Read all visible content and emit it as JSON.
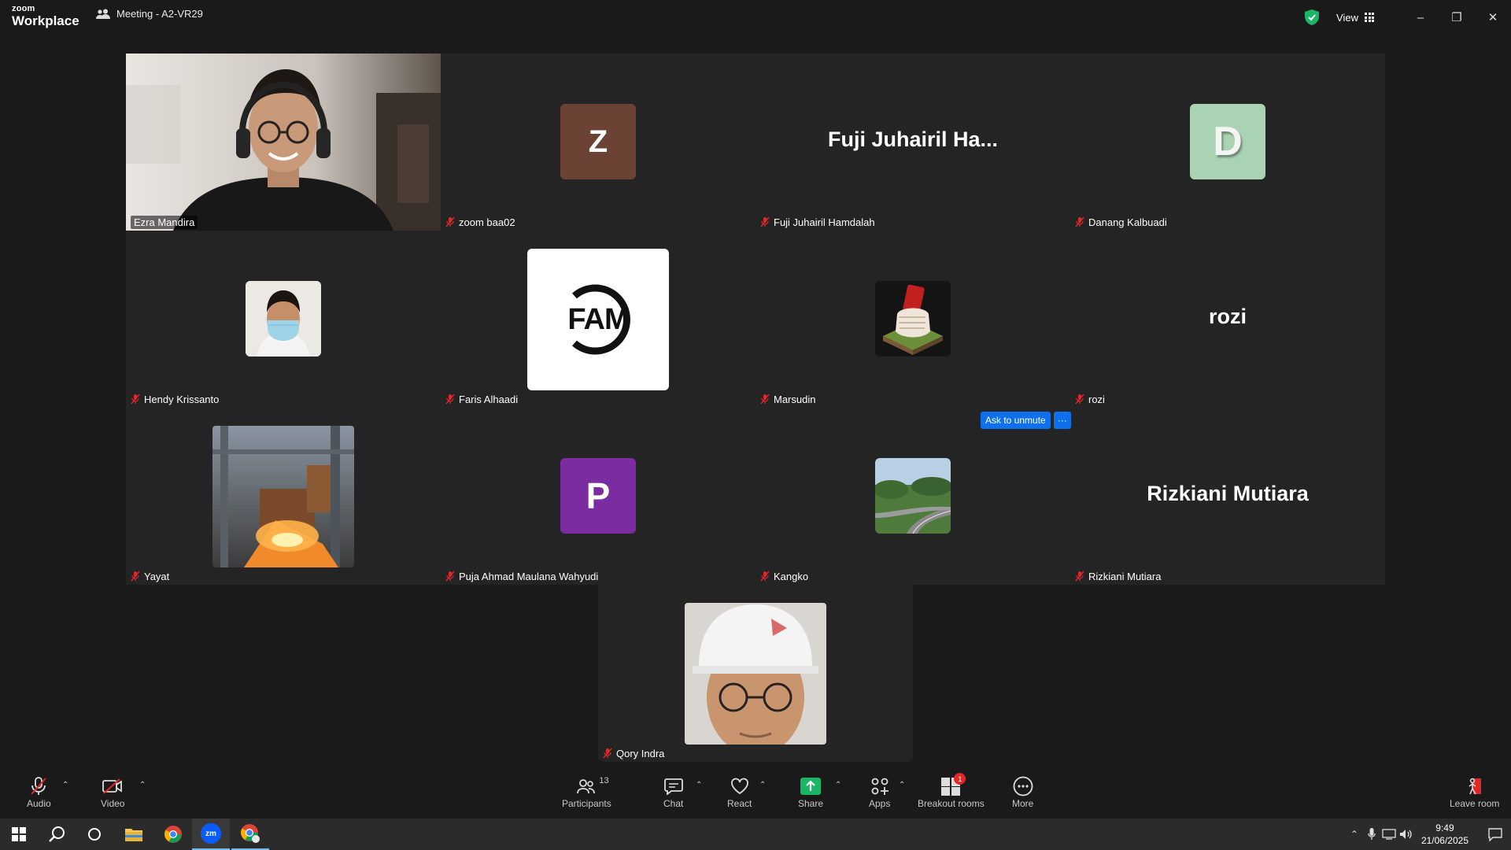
{
  "app": {
    "logo_line1": "zoom",
    "logo_line2": "Workplace",
    "meeting_title": "Meeting - A2-VR29"
  },
  "titlebar": {
    "view_label": "View",
    "minimize": "–",
    "restore": "❐",
    "close": "✕"
  },
  "participants": [
    {
      "name": "Ezra Mandira",
      "avatar": "video-feed",
      "active_speaker": true,
      "muted": false
    },
    {
      "name": "zoom baa02",
      "avatar": "initial",
      "initial": "Z",
      "color": "#6b4233",
      "muted": true
    },
    {
      "name": "Fuji Juhairil Hamdalah",
      "avatar": "name-text",
      "display": "Fuji Juhairil Ha...",
      "muted": true
    },
    {
      "name": "Danang Kalbuadi",
      "avatar": "initial",
      "initial": "D",
      "color": "#a9d3b2",
      "muted": true
    },
    {
      "name": "Hendy Krissanto",
      "avatar": "photo",
      "muted": true
    },
    {
      "name": "Faris Alhaadi",
      "avatar": "logo",
      "logo_text": "FAM",
      "muted": true
    },
    {
      "name": "Marsudin",
      "avatar": "photo",
      "muted": true
    },
    {
      "name": "rozi",
      "avatar": "name-text",
      "display": "rozi",
      "muted": true
    },
    {
      "name": "Yayat",
      "avatar": "photo",
      "muted": true
    },
    {
      "name": "Puja Ahmad Maulana Wahyudi",
      "avatar": "initial",
      "initial": "P",
      "color": "#7a2ca0",
      "muted": true
    },
    {
      "name": "Kangko",
      "avatar": "photo",
      "muted": true
    },
    {
      "name": "Rizkiani Mutiara",
      "avatar": "name-text",
      "display": "Rizkiani Mutiara",
      "muted": true
    },
    {
      "name": "Qory Indra",
      "avatar": "photo",
      "muted": true
    }
  ],
  "hover_actions": {
    "ask_unmute": "Ask to unmute",
    "more": "···"
  },
  "toolbar": {
    "audio": "Audio",
    "video": "Video",
    "participants": "Participants",
    "participant_count": "13",
    "chat": "Chat",
    "react": "React",
    "share": "Share",
    "apps": "Apps",
    "breakout": "Breakout rooms",
    "breakout_badge": "1",
    "more": "More",
    "leave": "Leave room"
  },
  "taskbar": {
    "time": "9:49",
    "date": "21/06/2025",
    "zoom_label": "zm"
  },
  "colors": {
    "active_border": "#23d9a1",
    "share_green": "#1bb665",
    "blue": "#0e71eb",
    "mute_red": "#e02828"
  }
}
